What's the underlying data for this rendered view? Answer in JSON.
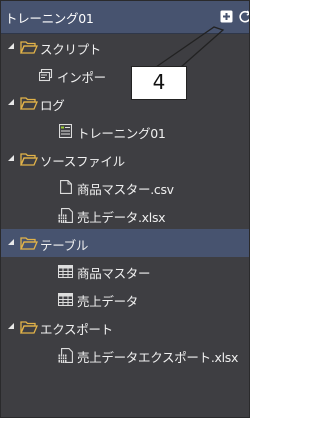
{
  "panel": {
    "title": "トレーニング01",
    "icons": {
      "new": "new-item-icon",
      "refresh": "refresh-icon"
    }
  },
  "callout": {
    "number": "4"
  },
  "tree": {
    "scripts": {
      "label": "スクリプト",
      "children": [
        "インポー"
      ]
    },
    "logs": {
      "label": "ログ",
      "children": [
        "トレーニング01"
      ]
    },
    "sources": {
      "label": "ソースファイル",
      "children": [
        "商品マスター.csv",
        "売上データ.xlsx"
      ]
    },
    "tables": {
      "label": "テーブル",
      "children": [
        "商品マスター",
        "売上データ"
      ]
    },
    "exports": {
      "label": "エクスポート",
      "children": [
        "売上データエクスポート.xlsx"
      ]
    }
  },
  "colors": {
    "panel_bg": "#3e3e42",
    "header_bg": "#47536f",
    "selected_bg": "#47536f",
    "folder": "#e2b349"
  }
}
